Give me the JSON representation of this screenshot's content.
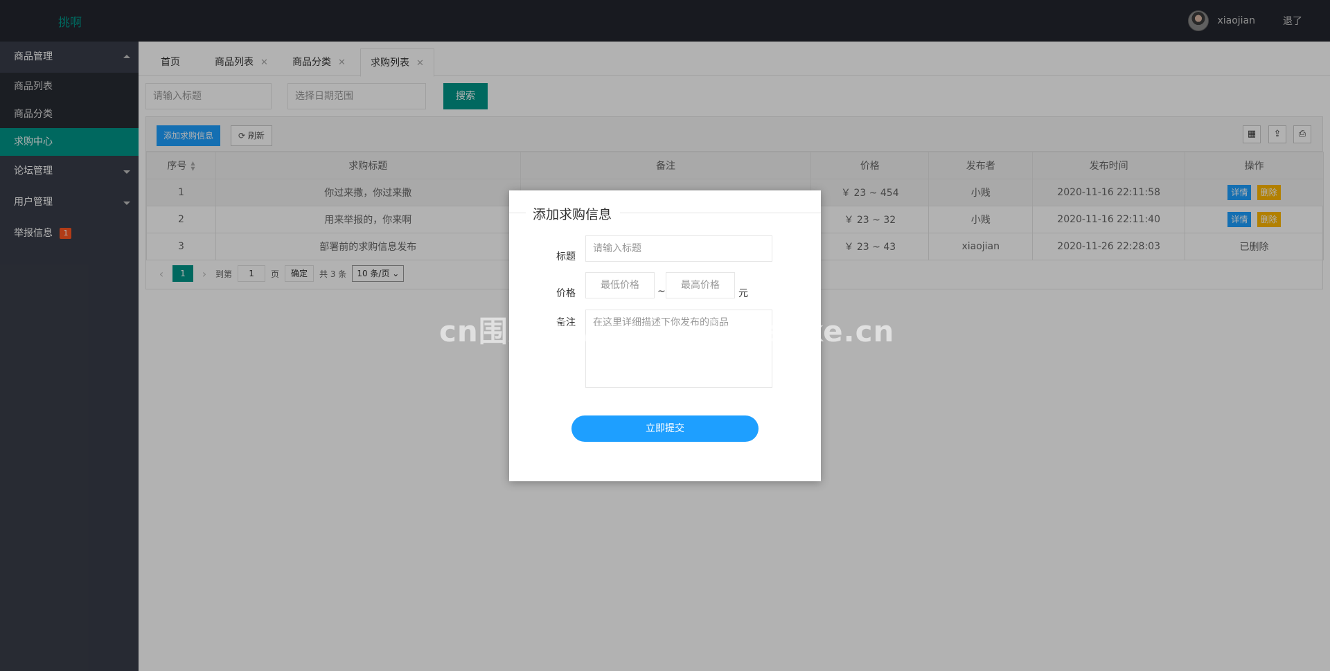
{
  "header": {
    "logo": "挑啊",
    "username": "xiaojian",
    "logout": "退了"
  },
  "sidebar": {
    "groups": [
      {
        "label": "商品管理",
        "items": [
          {
            "label": "商品列表"
          },
          {
            "label": "商品分类"
          },
          {
            "label": "求购中心"
          }
        ]
      },
      {
        "label": "论坛管理"
      },
      {
        "label": "用户管理"
      },
      {
        "label": "举报信息",
        "badge": "1"
      }
    ]
  },
  "tabs": [
    {
      "label": "首页"
    },
    {
      "label": "商品列表"
    },
    {
      "label": "商品分类"
    },
    {
      "label": "求购列表"
    }
  ],
  "search": {
    "title_placeholder": "请输入标题",
    "date_placeholder": "选择日期范围",
    "button": "搜索"
  },
  "toolbar": {
    "add_button": "添加求购信息",
    "refresh_button": "刷新"
  },
  "table": {
    "columns": [
      "序号",
      "求购标题",
      "备注",
      "价格",
      "发布者",
      "发布时间",
      "操作"
    ],
    "rows": [
      {
        "id": "1",
        "title": "你过来撒，你过来撒",
        "remark": "",
        "price": "￥ 23 ~ 454",
        "publisher": "小贱",
        "time": "2020-11-16 22:11:58",
        "ops": [
          "详情",
          "删除"
        ]
      },
      {
        "id": "2",
        "title": "用来举报的，你来啊",
        "remark": "",
        "price": "￥ 23 ~ 32",
        "publisher": "小贱",
        "time": "2020-11-16 22:11:40",
        "ops": [
          "详情",
          "删除"
        ]
      },
      {
        "id": "3",
        "title": "部署前的求购信息发布",
        "remark": "",
        "price": "￥ 23 ~ 43",
        "publisher": "xiaojian",
        "time": "2020-11-26 22:28:03",
        "status": "已删除"
      }
    ]
  },
  "pager": {
    "current": "1",
    "goto_label": "到第",
    "goto_value": "1",
    "page_unit": "页",
    "confirm": "确定",
    "total": "共 3 条",
    "page_size": "10 条/页"
  },
  "modal": {
    "title": "添加求购信息",
    "title_label": "标题",
    "title_placeholder": "请输入标题",
    "price_label": "价格",
    "min_placeholder": "最低价格",
    "tilde": "~",
    "max_placeholder": "最高价格",
    "unit": "元",
    "remark_label": "备注",
    "remark_placeholder": "在这里详细描述下你发布的商品",
    "submit": "立即提交"
  },
  "watermark": "cn围观客www.weiguanke.cn"
}
